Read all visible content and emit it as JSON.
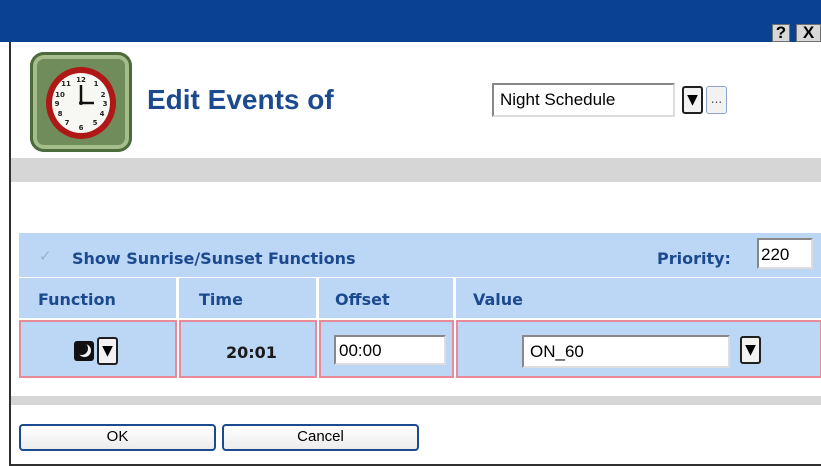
{
  "title_bar": {
    "help_label": "?",
    "close_label": "X"
  },
  "header": {
    "icon": "clock-icon",
    "title": "Edit Events of",
    "schedule": {
      "selected": "Night Schedule",
      "dropdown_glyph": "▼",
      "ellipsis_label": "..."
    }
  },
  "options": {
    "show_sunrise_sunset": {
      "checked": true,
      "label": "Show Sunrise/Sunset Functions"
    },
    "priority_label": "Priority:",
    "priority_value": "220"
  },
  "table": {
    "columns": [
      "Function",
      "Time",
      "Offset",
      "Value"
    ],
    "rows": [
      {
        "function_icon": "moon-icon",
        "dropdown_glyph": "▼",
        "time": "20:01",
        "offset": "00:00",
        "value": "ON_60"
      }
    ]
  },
  "buttons": {
    "ok": "OK",
    "cancel": "Cancel"
  },
  "colors": {
    "title_bar": "#0b4191",
    "header_text": "#1c4a8f",
    "table_bg": "#bcd6f6",
    "cell_border": "#e98a98"
  }
}
